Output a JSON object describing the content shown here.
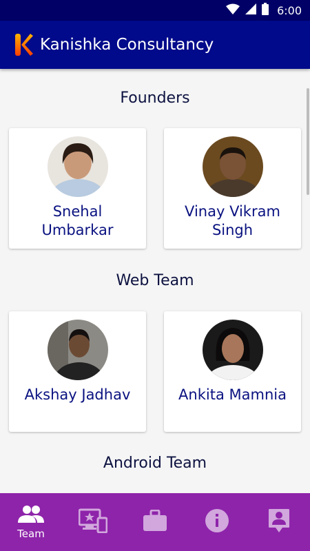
{
  "status_bar": {
    "time": "6:00"
  },
  "app_bar": {
    "title": "Kanishka Consultancy"
  },
  "sections": [
    {
      "title": "Founders",
      "members": [
        {
          "name": "Snehal Umbarkar"
        },
        {
          "name": "Vinay Vikram Singh"
        }
      ]
    },
    {
      "title": "Web Team",
      "members": [
        {
          "name": "Akshay Jadhav"
        },
        {
          "name": "Ankita Mamnia"
        }
      ]
    },
    {
      "title": "Android Team",
      "members": []
    }
  ],
  "bottom_nav": {
    "items": [
      {
        "label": "Team",
        "icon": "team-icon",
        "active": true
      },
      {
        "label": "",
        "icon": "services-icon",
        "active": false
      },
      {
        "label": "",
        "icon": "briefcase-icon",
        "active": false
      },
      {
        "label": "",
        "icon": "info-icon",
        "active": false
      },
      {
        "label": "",
        "icon": "contact-icon",
        "active": false
      }
    ]
  },
  "colors": {
    "status_bar": "#000066",
    "app_bar": "#000a8a",
    "bottom_nav": "#8e24aa",
    "name_text": "#0a1280"
  }
}
